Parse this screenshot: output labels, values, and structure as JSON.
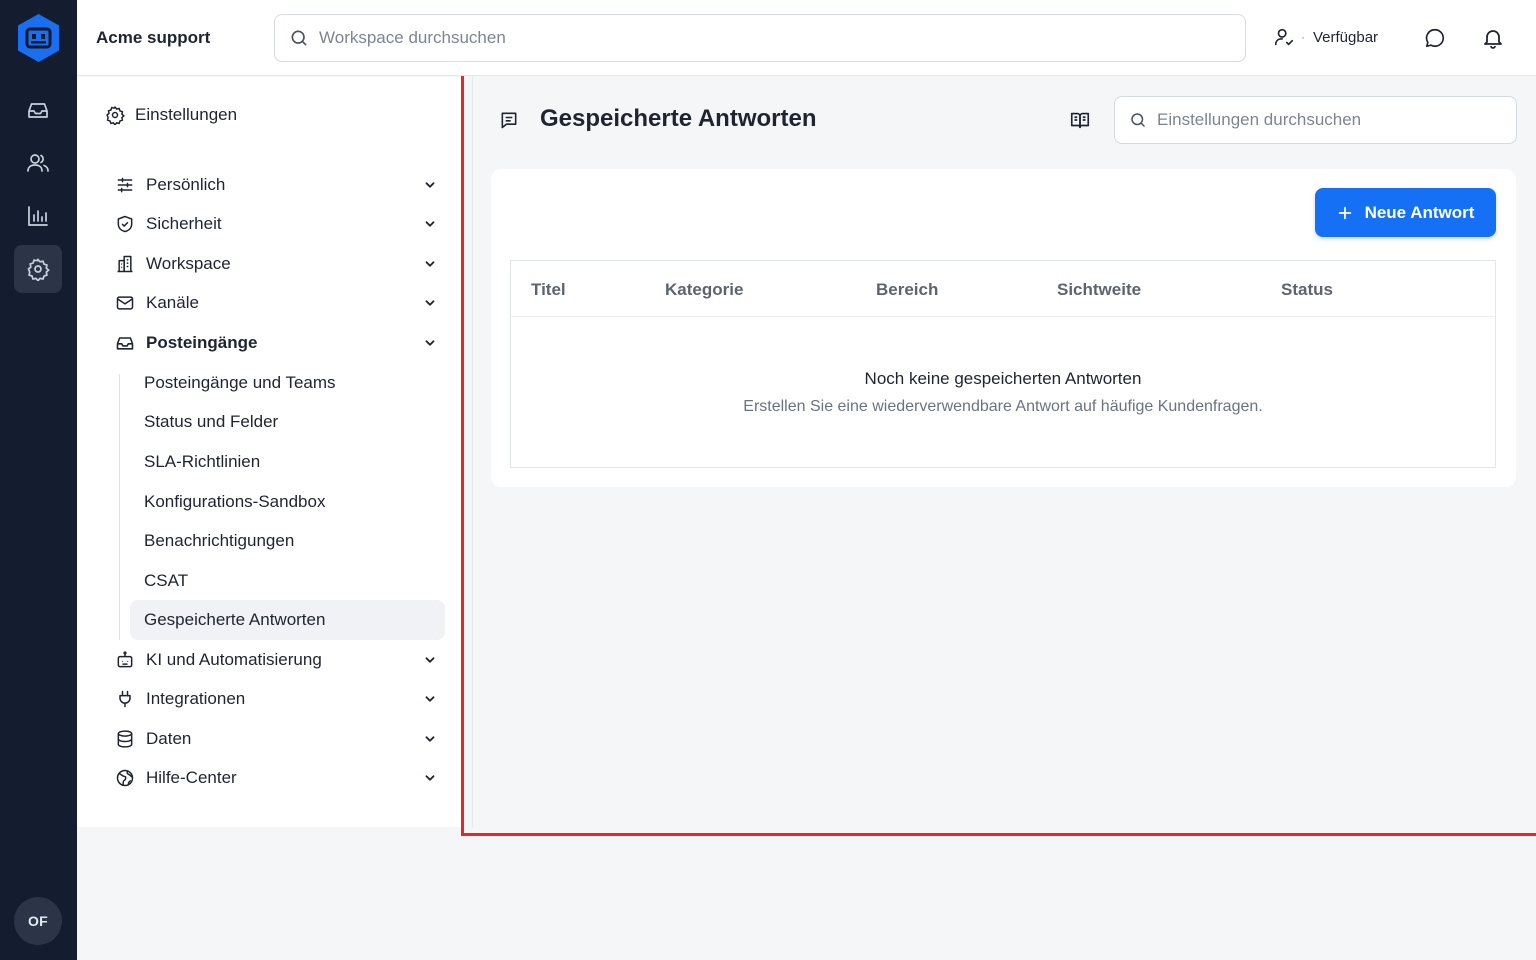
{
  "rail": {
    "items": [
      "inbox-icon",
      "contacts-icon",
      "reports-icon",
      "settings-icon"
    ],
    "active": "settings-icon",
    "avatar_initials": "OF"
  },
  "topbar": {
    "workspace_name": "Acme support",
    "search_placeholder": "Workspace durchsuchen",
    "presence_status": "Verfügbar",
    "presence_separator": "·"
  },
  "settings_nav": {
    "heading": "Einstellungen",
    "sections": [
      {
        "label": "Persönlich",
        "icon": "sliders-icon"
      },
      {
        "label": "Sicherheit",
        "icon": "shield-icon"
      },
      {
        "label": "Workspace",
        "icon": "building-icon"
      },
      {
        "label": "Kanäle",
        "icon": "mail-icon"
      },
      {
        "label": "Posteingänge",
        "icon": "inbox-icon"
      },
      {
        "label": "KI und Automatisierung",
        "icon": "robot-icon"
      },
      {
        "label": "Integrationen",
        "icon": "plug-icon"
      },
      {
        "label": "Daten",
        "icon": "database-icon"
      },
      {
        "label": "Hilfe-Center",
        "icon": "globe-icon"
      }
    ],
    "expanded_section": "Posteingänge",
    "sub_items": [
      "Posteingänge und Teams",
      "Status und Felder",
      "SLA-Richtlinien",
      "Konfigurations-Sandbox",
      "Benachrichtigungen",
      "CSAT",
      "Gespeicherte Antworten"
    ],
    "active_sub_item": "Gespeicherte Antworten"
  },
  "main": {
    "title": "Gespeicherte Antworten",
    "search_placeholder": "Einstellungen durchsuchen",
    "new_button_label": "Neue Antwort",
    "columns": [
      "Titel",
      "Kategorie",
      "Bereich",
      "Sichtweite",
      "Status"
    ],
    "empty_title": "Noch keine gespeicherten Antworten",
    "empty_subtitle": "Erstellen Sie eine wiederverwendbare Antwort auf häufige Kundenfragen."
  },
  "colors": {
    "rail_bg": "#141d2f",
    "accent": "#1570f5",
    "highlight_border": "#e5252f"
  }
}
